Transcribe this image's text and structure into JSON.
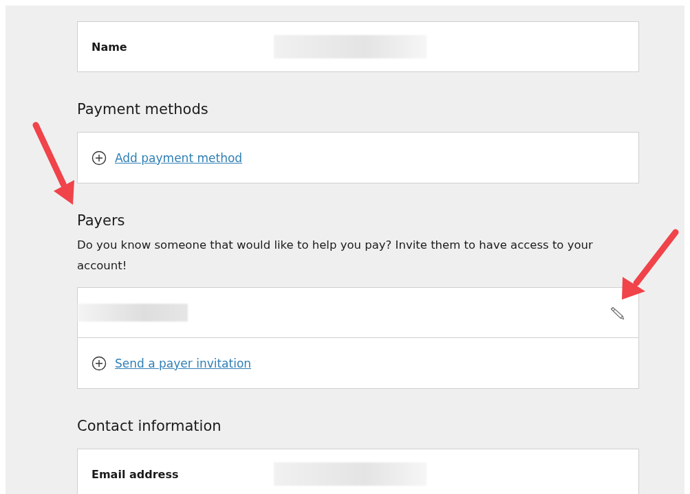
{
  "sections": [
    {
      "rows": [
        {
          "kind": "field",
          "label": "Name",
          "value_redacted": true
        }
      ]
    },
    {
      "heading": "Payment methods",
      "rows": [
        {
          "kind": "add",
          "link": "Add payment method"
        }
      ]
    },
    {
      "heading": "Payers",
      "description": "Do you know someone that would like to help you pay? Invite them to have access to your account!",
      "rows": [
        {
          "kind": "entry",
          "value_redacted": true,
          "editable": true
        },
        {
          "kind": "add",
          "link": "Send a payer invitation"
        }
      ]
    },
    {
      "heading": "Contact information",
      "rows": [
        {
          "kind": "field",
          "label": "Email address",
          "value_redacted": true
        }
      ]
    }
  ]
}
